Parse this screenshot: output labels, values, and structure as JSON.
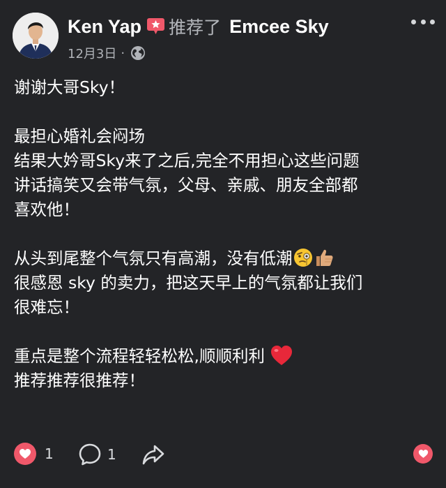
{
  "header": {
    "author_name": "Ken Yap",
    "action_text": "推荐了",
    "page_name": "Emcee Sky",
    "date": "12月3日",
    "separator": "·",
    "privacy_icon": "globe-icon",
    "more_icon": "more-horizontal-icon",
    "badge_icon": "recommend-star-icon"
  },
  "post": {
    "paragraphs": [
      {
        "lines": [
          "谢谢大哥Sky！"
        ]
      },
      {
        "lines": [
          "最担心婚礼会闷场",
          "结果大妗哥Sky来了之后,完全不用担心这些问题",
          "讲话搞笑又会带气氛，父母、亲戚、朋友全部都",
          "喜欢他！"
        ]
      },
      {
        "lines": [
          "从头到尾整个气氛只有高潮，没有低潮",
          "很感恩 sky 的卖力，把这天早上的气氛都让我们",
          "很难忘！"
        ]
      },
      {
        "lines": [
          "重点是整个流程轻轻松松,顺顺利利",
          "推荐推荐很推荐！"
        ]
      }
    ],
    "emojis": [
      "face-with-monocle",
      "thumbs-up",
      "red-heart"
    ]
  },
  "footer": {
    "reaction_count": "1",
    "comment_count": "1",
    "reaction_icon": "heart-reaction-icon",
    "comment_icon": "comment-bubble-icon",
    "share_icon": "share-arrow-icon"
  },
  "colors": {
    "background": "#232427",
    "text": "#ffffff",
    "muted": "#b0b3b8",
    "reaction": "#f0586a"
  }
}
